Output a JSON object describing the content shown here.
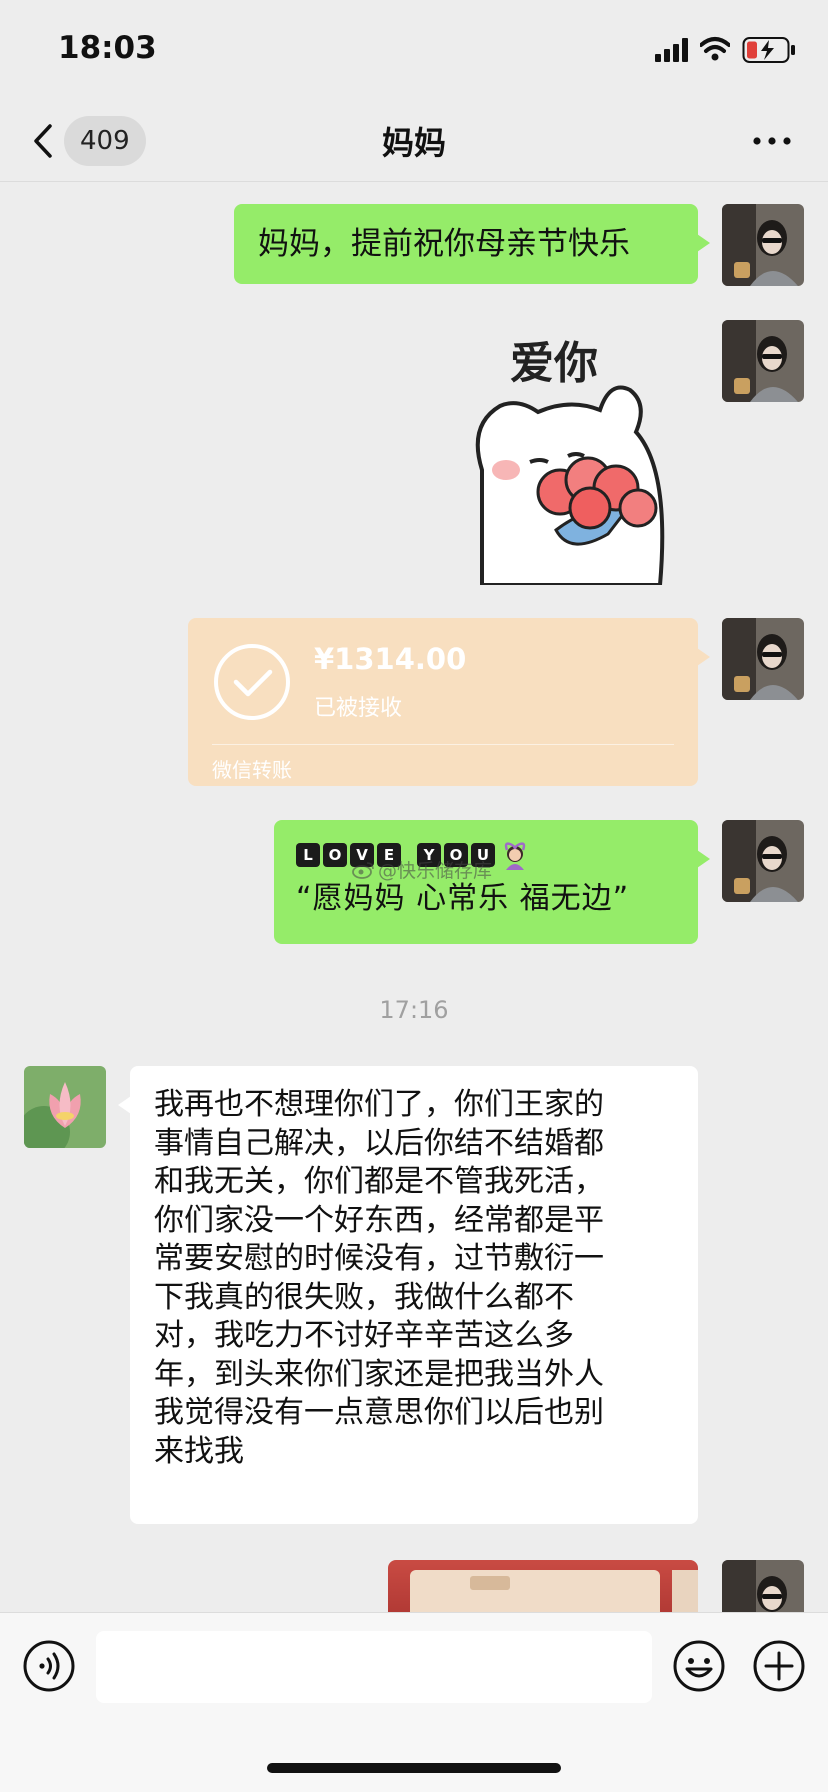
{
  "status_bar": {
    "time": "18:03",
    "icons": [
      "signal-icon",
      "wifi-icon",
      "battery-charging-icon"
    ]
  },
  "nav": {
    "back_icon": "chevron-left-icon",
    "unread_count": "409",
    "title": "妈妈",
    "more_icon": "more-icon"
  },
  "messages": {
    "greeting": "妈妈，提前祝你母亲节快乐",
    "sticker_text": "爱你",
    "transfer": {
      "amount": "¥1314.00",
      "status": "已被接收",
      "label": "微信转账"
    },
    "love": {
      "letters": [
        "L",
        "O",
        "V",
        "E",
        "Y",
        "O",
        "U"
      ],
      "text": "“愿妈妈 心常乐 福无边”"
    },
    "watermark": "@快乐储存库",
    "timestamp": "17:16",
    "long_reply_lines": [
      "我再也不想理你们了，你们王家的",
      "事情自己解决，以后你结不结婚都",
      "和我无关，你们都是不管我死活，",
      "你们家没一个好东西，经常都是平",
      "常要安慰的时候没有，过节敷衍一",
      "下我真的很失败，我做什么都不",
      "对，我吃力不讨好辛辛苦这么多",
      "年，到头来你们家还是把我当外人",
      "我觉得没有一点意思你们以后也别",
      "来找我"
    ]
  },
  "input_bar": {
    "voice_icon": "voice-icon",
    "emoji_icon": "emoji-icon",
    "plus_icon": "plus-icon"
  },
  "colors": {
    "self_bubble": "#95ec69",
    "other_bubble": "#ffffff",
    "transfer_bubble": "#f8dfc0",
    "background": "#ededed"
  }
}
